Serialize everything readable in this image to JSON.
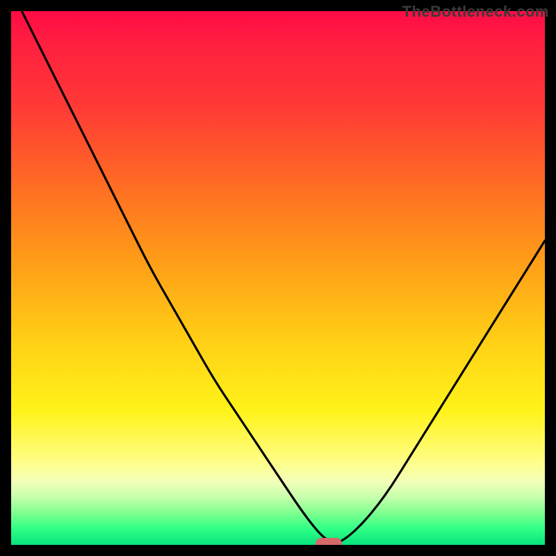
{
  "watermark": "TheBottleneck.com",
  "colors": {
    "frame": "#000000",
    "curve": "#000000",
    "marker": "#d46a6a"
  },
  "chart_data": {
    "type": "line",
    "title": "",
    "xlabel": "",
    "ylabel": "",
    "xlim": [
      0,
      100
    ],
    "ylim": [
      0,
      100
    ],
    "grid": false,
    "series": [
      {
        "name": "bottleneck-curve",
        "x": [
          2,
          6,
          10,
          14,
          18,
          22,
          26,
          30,
          34,
          38,
          42,
          46,
          50,
          54,
          57,
          59,
          61,
          65,
          70,
          75,
          80,
          85,
          90,
          95,
          100
        ],
        "y": [
          100,
          92,
          84,
          76,
          68,
          60,
          52,
          45,
          38,
          31,
          25,
          19,
          13,
          7,
          3,
          1,
          0,
          3,
          9,
          17,
          25,
          33,
          41,
          49,
          57
        ]
      }
    ],
    "marker": {
      "x_start": 57,
      "x_end": 62,
      "y": 0
    },
    "background_gradient_stops": [
      {
        "pos": 0,
        "color": "#ff0b46"
      },
      {
        "pos": 18,
        "color": "#ff3a36"
      },
      {
        "pos": 46,
        "color": "#ff9a18"
      },
      {
        "pos": 75,
        "color": "#fff31a"
      },
      {
        "pos": 91,
        "color": "#c8ffad"
      },
      {
        "pos": 100,
        "color": "#08e27d"
      }
    ]
  }
}
